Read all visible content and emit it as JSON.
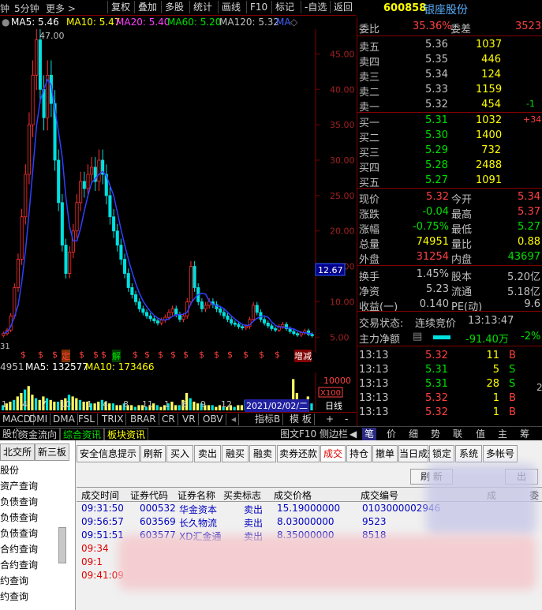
{
  "toolbar": {
    "period_left": "钟",
    "period_5min": "5分钟",
    "more": "更多 >",
    "buttons": [
      "复权",
      "叠加",
      "多股",
      "统计",
      "画线",
      "F10",
      "标记",
      "-自选",
      "返回"
    ]
  },
  "stock": {
    "code": "600858",
    "name": "银座股份"
  },
  "ma_line": {
    "ma5": "MA5: 5.46",
    "ma10": "MA10: 5.47",
    "ma20": "MA20: 5.40",
    "ma60": "MA60: 5.20",
    "ma120": "MA120: 5.32",
    "ma_tag": "MA",
    "colors": {
      "ma5": "#ffffff",
      "ma10": "#ffff00",
      "ma20": "#ff40ff",
      "ma60": "#00e000",
      "ma120": "#c0c0c0"
    }
  },
  "chart_data": {
    "type": "candlestick",
    "peak_label": "47.00",
    "y_ticks": [
      "45.00",
      "40.00",
      "35.00",
      "30.00",
      "25.00",
      "20.00",
      "15.00",
      "10.00",
      "5.00"
    ],
    "ylim": [
      2.8,
      48.5
    ],
    "current_price_tag": "12.67",
    "left_edge_label": "31",
    "end_label": "增减",
    "event_markers": [
      "定",
      "解"
    ],
    "closes": [
      5.5,
      6,
      8,
      12,
      16,
      22,
      28,
      35,
      42,
      47,
      40,
      36,
      42,
      38,
      30,
      24,
      18,
      14,
      17,
      20,
      24,
      27,
      26,
      28,
      29,
      27,
      30,
      28,
      25,
      22,
      20,
      18,
      16,
      14,
      12,
      11,
      10,
      9,
      8.5,
      8,
      7.6,
      7.3,
      7,
      7.4,
      7.8,
      8.5,
      9,
      8.2,
      7.5,
      8,
      10,
      15,
      12,
      10,
      9,
      9.5,
      10,
      9.6,
      9,
      8.5,
      8,
      7.5,
      7,
      6.8,
      6.5,
      6.3,
      6.5,
      7.5,
      9.5,
      8.5,
      7.5,
      7,
      6.6,
      6.2,
      6,
      6.5,
      6.8,
      6.2,
      5.8,
      5.5,
      5.3,
      5.6,
      5.9,
      5.4,
      5.2
    ]
  },
  "volume": {
    "label_left": "4951",
    "ma5": "MA5: 132577",
    "ma10": "MA10: 173466",
    "y_tick": "10000",
    "x_unit": "X100",
    "date_tag": "2021/02/02/二",
    "period_label": "日线",
    "bars": [
      3,
      4,
      5,
      6,
      8,
      10,
      12,
      14,
      9,
      7,
      6,
      8,
      7,
      6,
      5,
      5,
      6,
      7,
      9,
      8,
      7,
      6,
      5,
      5,
      4,
      4,
      5,
      6,
      5,
      4,
      4,
      3,
      3,
      4,
      3,
      3,
      2,
      3,
      3,
      2,
      3,
      4,
      3,
      2,
      3,
      4,
      5,
      3,
      3,
      6,
      10,
      7,
      5,
      4,
      4,
      3,
      3,
      3,
      2,
      3,
      2,
      2,
      3,
      2,
      3,
      3,
      6,
      4,
      3,
      3,
      2,
      3,
      3,
      3,
      4,
      3,
      3,
      2,
      3,
      18,
      10,
      6,
      5,
      8,
      4
    ],
    "x_ticks": [
      "1",
      "4",
      "7",
      "10",
      "1",
      "4",
      "8",
      "11",
      "1",
      "6",
      "9",
      "12"
    ]
  },
  "indicator_tabs": [
    "MACD",
    "DMI",
    "DMA",
    "FSL",
    "TRIX",
    "BRAR",
    "CR",
    "VR",
    "OBV"
  ],
  "indicator_right": [
    "指标B",
    "模 板",
    "+",
    "-"
  ],
  "news_bar": {
    "left": [
      "股价",
      "资金流向",
      "综合资讯",
      "板块资讯"
    ],
    "f10": "图文F10",
    "side": "侧边栏",
    "more": "◀",
    "right_tabs": [
      "笔",
      "价",
      "细",
      "势",
      "联",
      "值",
      "主",
      "筹"
    ]
  },
  "orderbook": {
    "wei_bi_label": "委比",
    "wei_bi": "35.36%",
    "wei_cha_label": "委差",
    "wei_cha": "3523",
    "asks": [
      {
        "label": "卖五",
        "price": "5.36",
        "vol": "1037",
        "chg": ""
      },
      {
        "label": "卖四",
        "price": "5.35",
        "vol": "446",
        "chg": ""
      },
      {
        "label": "卖三",
        "price": "5.34",
        "vol": "124",
        "chg": ""
      },
      {
        "label": "卖二",
        "price": "5.33",
        "vol": "1159",
        "chg": ""
      },
      {
        "label": "卖一",
        "price": "5.32",
        "vol": "454",
        "chg": "-1"
      }
    ],
    "bids": [
      {
        "label": "买一",
        "price": "5.31",
        "vol": "1032",
        "chg": "+34"
      },
      {
        "label": "买二",
        "price": "5.30",
        "vol": "1400",
        "chg": ""
      },
      {
        "label": "买三",
        "price": "5.29",
        "vol": "732",
        "chg": ""
      },
      {
        "label": "买四",
        "price": "5.28",
        "vol": "2488",
        "chg": ""
      },
      {
        "label": "买五",
        "price": "5.27",
        "vol": "1091",
        "chg": ""
      }
    ]
  },
  "quote": {
    "rows": [
      {
        "l1": "现价",
        "v1": "5.32",
        "c1": "#ff4040",
        "l2": "今开",
        "v2": "5.34",
        "c2": "#ff4040"
      },
      {
        "l1": "涨跌",
        "v1": "-0.04",
        "c1": "#00e000",
        "l2": "最高",
        "v2": "5.37",
        "c2": "#ff4040"
      },
      {
        "l1": "涨幅",
        "v1": "-0.75%",
        "c1": "#00e000",
        "l2": "最低",
        "v2": "5.27",
        "c2": "#00e000"
      },
      {
        "l1": "总量",
        "v1": "74951",
        "c1": "#ffff00",
        "l2": "量比",
        "v2": "0.88",
        "c2": "#ffff00"
      },
      {
        "l1": "外盘",
        "v1": "31254",
        "c1": "#ff4040",
        "l2": "内盘",
        "v2": "43697",
        "c2": "#00e000"
      }
    ],
    "rows2": [
      {
        "l1": "换手",
        "v1": "1.45%",
        "l2": "股本",
        "v2": "5.20亿"
      },
      {
        "l1": "净资",
        "v1": "5.23",
        "l2": "流通",
        "v2": "5.18亿"
      },
      {
        "l1": "收益(一)",
        "v1": "0.140",
        "l2": "PE(动)",
        "v2": "9.6"
      }
    ],
    "status_label": "交易状态:",
    "status_value": "连续竞价",
    "status_time": "13:13:47",
    "netflow_label": "主力净额",
    "netflow_value": "-91.40万",
    "netflow_pct": "-2%"
  },
  "ticks": [
    {
      "time": "13:13",
      "price": "5.32",
      "pc": "#ff4040",
      "vol": "11",
      "side": "B"
    },
    {
      "time": "13:13",
      "price": "5.31",
      "pc": "#00e000",
      "vol": "5",
      "side": "S"
    },
    {
      "time": "13:13",
      "price": "5.31",
      "pc": "#00e000",
      "vol": "28",
      "side": "S"
    },
    {
      "time": "13:13",
      "price": "5.32",
      "pc": "#ff4040",
      "vol": "1",
      "side": "B"
    },
    {
      "time": "13:13",
      "price": "5.32",
      "pc": "#ff4040",
      "vol": "1",
      "side": "B"
    }
  ],
  "tick_extra": "2",
  "trade_panel": {
    "nav_tabs": [
      "北交所",
      "新三板"
    ],
    "nav_items": [
      "股份",
      "资产查询",
      "负债查询",
      "负债查询",
      "负债查询",
      "合约查询",
      "合约查询",
      "约查询",
      "约查询"
    ],
    "buttons": [
      "安全信息提示",
      "刷新",
      "买入",
      "卖出",
      "融买",
      "融卖",
      "卖券还款",
      "成交",
      "持仓",
      "撤单",
      "当日成交",
      "锁定",
      "系统",
      "多帐号"
    ],
    "active_button": "成交",
    "sub_buttons": [
      "刷 新",
      "出"
    ],
    "columns": [
      "成交时间",
      "证券代码",
      "证券名称",
      "买卖标志",
      "成交价格",
      "成交编号",
      "成",
      "委"
    ],
    "rows": [
      {
        "time": "09:31:50",
        "code": "000532",
        "name": "华金资本",
        "flag": "卖出",
        "price": "15.19000000",
        "id": "0103000002946",
        "color": "#0000c0"
      },
      {
        "time": "09:56:57",
        "code": "603569",
        "name": "长久物流",
        "flag": "卖出",
        "price": "8.03000000",
        "id": "9523",
        "color": "#0000c0"
      },
      {
        "time": "09:51:51",
        "code": "603577",
        "name": "XD汇金通",
        "flag": "卖出",
        "price": "8.35000000",
        "id": "8518",
        "color": "#0000c0"
      },
      {
        "time": "09:34",
        "code": "",
        "name": "",
        "flag": "",
        "price": "",
        "id": "",
        "color": "#e00000"
      },
      {
        "time": "09:1",
        "code": "",
        "name": "",
        "flag": "",
        "price": "",
        "id": "",
        "color": "#e00000"
      },
      {
        "time": "09:41:09",
        "code": "",
        "name": "",
        "flag": "",
        "price": "",
        "id": "",
        "color": "#e00000"
      }
    ]
  }
}
